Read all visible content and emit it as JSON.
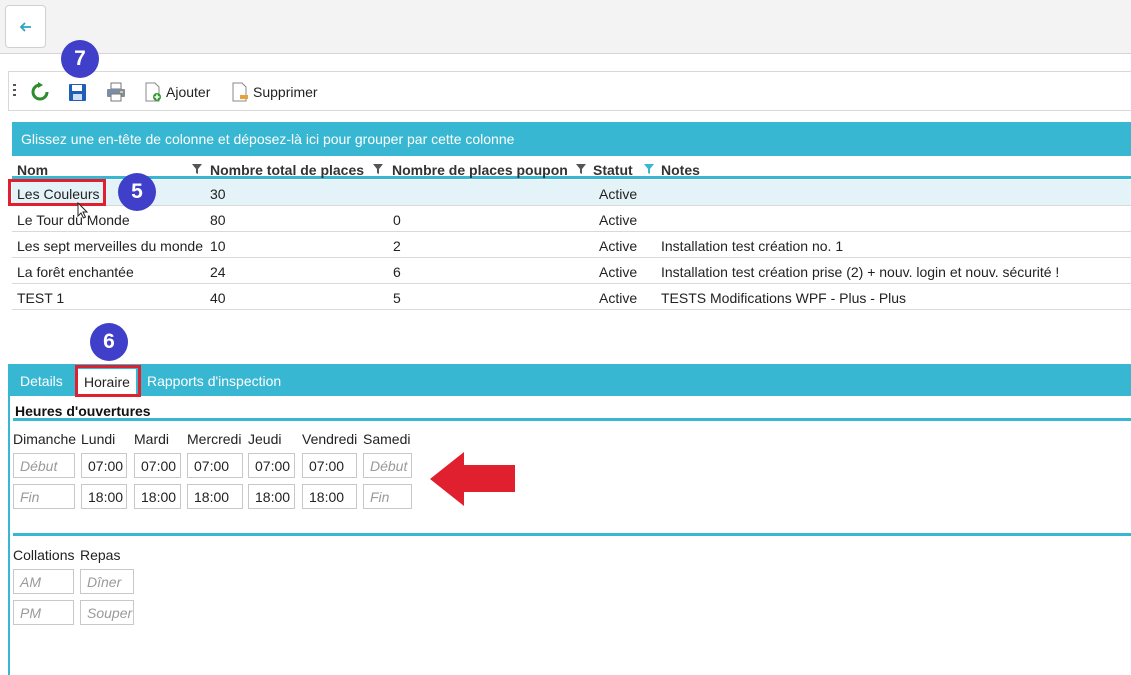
{
  "toolbar": {
    "add_label": "Ajouter",
    "delete_label": "Supprimer"
  },
  "badges": {
    "save": "7",
    "row": "5",
    "tab": "6"
  },
  "group_hint": "Glissez une en-tête de colonne et déposez-là ici pour grouper par cette colonne",
  "columns": [
    "Nom",
    "Nombre total de places",
    "Nombre de places poupon",
    "Statut",
    "Notes"
  ],
  "rows": [
    {
      "nom": "Les Couleurs",
      "total": "30",
      "poupon": "",
      "statut": "Active",
      "notes": ""
    },
    {
      "nom": "Le Tour du Monde",
      "total": "80",
      "poupon": "0",
      "statut": "Active",
      "notes": ""
    },
    {
      "nom": "Les sept merveilles du monde",
      "total": "10",
      "poupon": "2",
      "statut": "Active",
      "notes": "Installation test création no. 1"
    },
    {
      "nom": "La forêt enchantée",
      "total": "24",
      "poupon": "6",
      "statut": "Active",
      "notes": "Installation test création prise (2) + nouv. login et nouv. sécurité !"
    },
    {
      "nom": "TEST 1",
      "total": "40",
      "poupon": "5",
      "statut": "Active",
      "notes": "TESTS Modifications WPF - Plus - Plus"
    }
  ],
  "tabs": [
    "Details",
    "Horaire",
    "Rapports d'inspection"
  ],
  "schedule": {
    "title": "Heures d'ouvertures",
    "days": [
      "Dimanche",
      "Lundi",
      "Mardi",
      "Mercredi",
      "Jeudi",
      "Vendredi",
      "Samedi"
    ],
    "start_placeholder": "Début",
    "end_placeholder": "Fin",
    "start": [
      "",
      "07:00",
      "07:00",
      "07:00",
      "07:00",
      "07:00",
      ""
    ],
    "end": [
      "",
      "18:00",
      "18:00",
      "18:00",
      "18:00",
      "18:00",
      ""
    ]
  },
  "meals": {
    "collations_label": "Collations",
    "repas_label": "Repas",
    "am_placeholder": "AM",
    "pm_placeholder": "PM",
    "diner_placeholder": "Dîner",
    "souper_placeholder": "Souper"
  },
  "colors": {
    "accent": "#37b7d2",
    "badge": "#3f3fc9",
    "highlight": "#e0202e",
    "selected_row": "#e4f3f8"
  }
}
